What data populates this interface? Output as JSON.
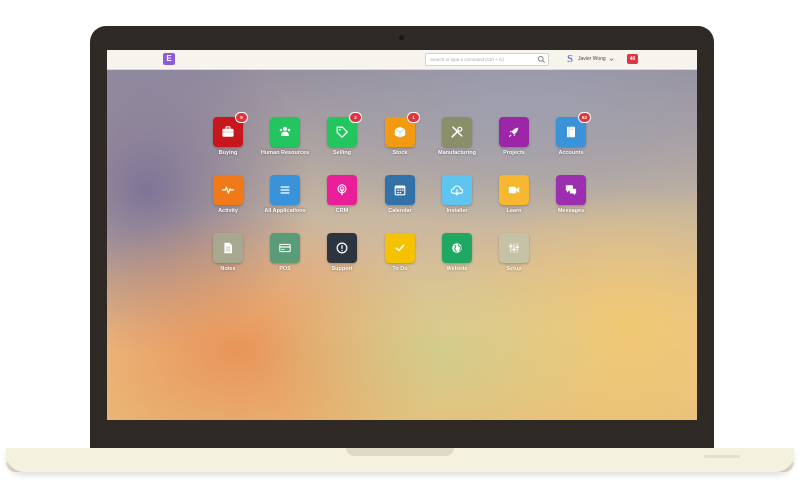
{
  "navbar": {
    "brand_letter": "E",
    "search_placeholder": "Search or type a command (Ctrl + G)",
    "user_initial": "S",
    "user_name": "Javier Wong",
    "notification_count": "40"
  },
  "colors": {
    "brand": "#8e5ad9",
    "badge": "#e0343f"
  },
  "apps": [
    {
      "label": "Buying",
      "icon": "briefcase-icon",
      "color": "#c8161d",
      "badge": "9"
    },
    {
      "label": "Human Resources",
      "icon": "users-icon",
      "color": "#22c55e",
      "badge": ""
    },
    {
      "label": "Selling",
      "icon": "tag-icon",
      "color": "#22c55e",
      "badge": "2"
    },
    {
      "label": "Stock",
      "icon": "box-icon",
      "color": "#f29b12",
      "badge": "1"
    },
    {
      "label": "Manufacturing",
      "icon": "tools-icon",
      "color": "#8a8f6a",
      "badge": ""
    },
    {
      "label": "Projects",
      "icon": "rocket-icon",
      "color": "#9b27a8",
      "badge": ""
    },
    {
      "label": "Accounts",
      "icon": "book-icon",
      "color": "#3a93d9",
      "badge": "52"
    },
    {
      "label": "Activity",
      "icon": "pulse-icon",
      "color": "#f07a1a",
      "badge": ""
    },
    {
      "label": "All Applications",
      "icon": "list-icon",
      "color": "#3a93d9",
      "badge": ""
    },
    {
      "label": "CRM",
      "icon": "podcast-icon",
      "color": "#ea1e98",
      "badge": ""
    },
    {
      "label": "Calendar",
      "icon": "calendar-icon",
      "color": "#3272a8",
      "badge": ""
    },
    {
      "label": "Installer",
      "icon": "cloud-download-icon",
      "color": "#5fc4ee",
      "badge": ""
    },
    {
      "label": "Learn",
      "icon": "video-icon",
      "color": "#f7b731",
      "badge": ""
    },
    {
      "label": "Messages",
      "icon": "chat-icon",
      "color": "#9b2fb0",
      "badge": ""
    },
    {
      "label": "Notes",
      "icon": "file-icon",
      "color": "#a8a890",
      "badge": ""
    },
    {
      "label": "POS",
      "icon": "card-icon",
      "color": "#5a9c78",
      "badge": ""
    },
    {
      "label": "Support",
      "icon": "alert-icon",
      "color": "#2d3440",
      "badge": ""
    },
    {
      "label": "To Do",
      "icon": "check-icon",
      "color": "#f5c200",
      "badge": ""
    },
    {
      "label": "Website",
      "icon": "globe-icon",
      "color": "#1ea862",
      "badge": ""
    },
    {
      "label": "Setup",
      "icon": "sliders-icon",
      "color": "#c6c2a6",
      "badge": ""
    }
  ]
}
